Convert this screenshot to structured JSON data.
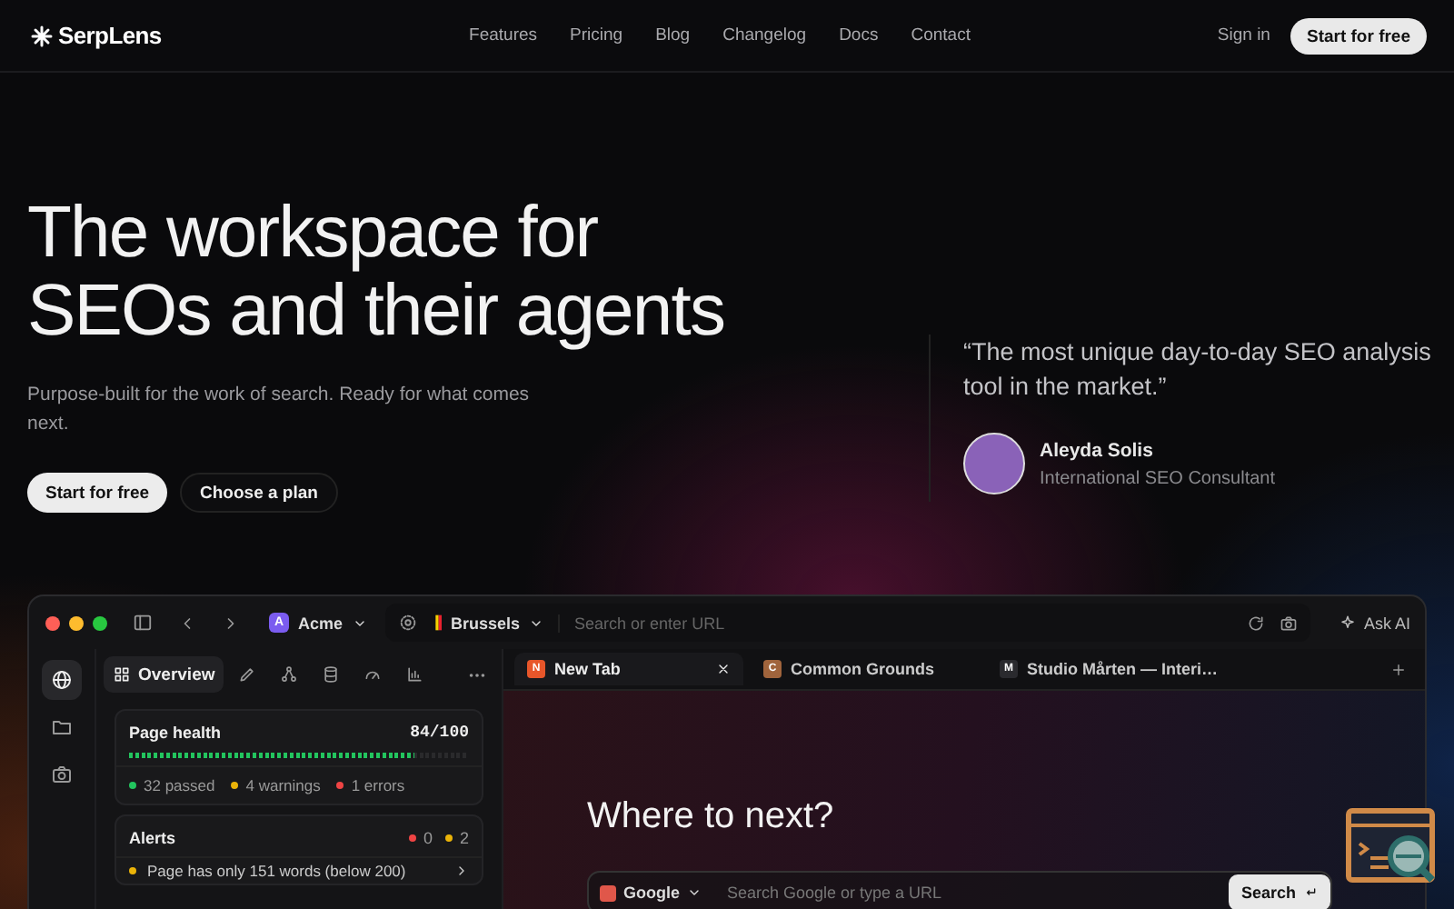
{
  "nav": {
    "brand": "SerpLens",
    "links": [
      "Features",
      "Pricing",
      "Blog",
      "Changelog",
      "Docs",
      "Contact"
    ],
    "sign_in": "Sign in",
    "cta": "Start for free"
  },
  "hero": {
    "title": "The workspace for SEOs and their agents",
    "subtitle": "Purpose-built for the work of search. Ready for what comes next.",
    "primary_button": "Start for free",
    "secondary_button": "Choose a plan"
  },
  "testimonial": {
    "quote": "“The most unique day-to-day SEO analysis tool in the market.”",
    "name": "Aleyda Solis",
    "role": "International SEO Consultant"
  },
  "app": {
    "workspace": "Acme",
    "workspace_badge": "A",
    "location": "Brussels",
    "url_placeholder": "Search or enter URL",
    "ask_ai": "Ask AI",
    "rail": [
      {
        "kind": "globe",
        "selected": true
      },
      {
        "kind": "folder",
        "selected": false
      },
      {
        "kind": "camera",
        "selected": false
      }
    ],
    "panel_tabs": [
      {
        "kind": "overview",
        "label": "Overview",
        "selected": true
      },
      {
        "kind": "pen",
        "selected": false
      },
      {
        "kind": "graph",
        "selected": false
      },
      {
        "kind": "database",
        "selected": false
      },
      {
        "kind": "gauge",
        "selected": false
      },
      {
        "kind": "chart",
        "selected": false
      }
    ],
    "page_health": {
      "title": "Page health",
      "score": "84/100",
      "level": 0.84,
      "stats": [
        {
          "label": "32 passed",
          "color": "#22c55e"
        },
        {
          "label": "4 warnings",
          "color": "#eab308"
        },
        {
          "label": "1 errors",
          "color": "#ef4444"
        }
      ]
    },
    "alerts": {
      "title": "Alerts",
      "counts": [
        {
          "value": "0",
          "color": "#ef4444"
        },
        {
          "value": "2",
          "color": "#eab308"
        }
      ],
      "items": [
        {
          "text": "Page has only 151 words (below 200)",
          "color": "#eab308"
        }
      ]
    },
    "browser_tabs": [
      {
        "badge": "N",
        "title": "New Tab",
        "color": "#e8562a",
        "selected": true,
        "closable": true
      },
      {
        "badge": "C",
        "title": "Common Grounds",
        "color": "#a0643c",
        "selected": false,
        "closable": false
      },
      {
        "badge": "M",
        "title": "Studio Mårten — Interi…",
        "color": "#2a2a2e",
        "selected": false,
        "closable": false
      }
    ],
    "new_tab": {
      "heading": "Where to next?",
      "engine": "Google",
      "placeholder": "Search Google or type a URL",
      "search_button": "Search"
    }
  }
}
